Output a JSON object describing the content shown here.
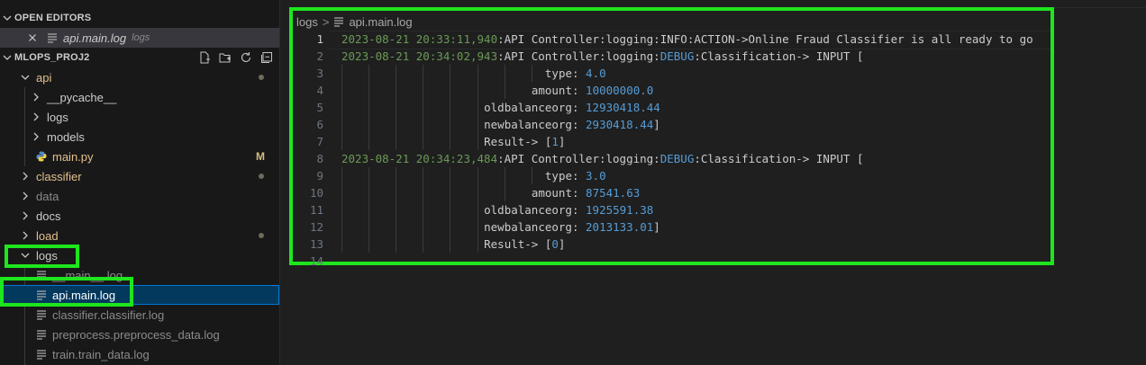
{
  "sidebar": {
    "open_editors": {
      "title": "OPEN EDITORS",
      "item": {
        "name": "api.main.log",
        "folder": "logs"
      }
    },
    "project": {
      "title": "MLOPS_PROJ2"
    },
    "tree": [
      {
        "label": "api",
        "kind": "folder",
        "open": true,
        "depth": 0,
        "color": "#e2c08d",
        "badge": "dot"
      },
      {
        "label": "__pycache__",
        "kind": "folder",
        "open": false,
        "depth": 1,
        "color": "#cccccc"
      },
      {
        "label": "logs",
        "kind": "folder",
        "open": false,
        "depth": 1,
        "color": "#cccccc"
      },
      {
        "label": "models",
        "kind": "folder",
        "open": false,
        "depth": 1,
        "color": "#cccccc"
      },
      {
        "label": "main.py",
        "kind": "python",
        "depth": 1,
        "color": "#e2c08d",
        "badge": "M"
      },
      {
        "label": "classifier",
        "kind": "folder",
        "open": false,
        "depth": 0,
        "color": "#e2c08d",
        "badge": "dot"
      },
      {
        "label": "data",
        "kind": "folder",
        "open": false,
        "depth": 0,
        "color": "#8b8b8b"
      },
      {
        "label": "docs",
        "kind": "folder",
        "open": false,
        "depth": 0,
        "color": "#cccccc"
      },
      {
        "label": "load",
        "kind": "folder",
        "open": false,
        "depth": 0,
        "color": "#e2c08d",
        "badge": "dot"
      },
      {
        "label": "logs",
        "kind": "folder",
        "open": true,
        "depth": 0,
        "color": "#cccccc"
      },
      {
        "label": "__main__.log",
        "kind": "log",
        "depth": 1,
        "color": "#8b8b8b"
      },
      {
        "label": "api.main.log",
        "kind": "log",
        "depth": 1,
        "color": "#ffffff",
        "selected": true
      },
      {
        "label": "classifier.classifier.log",
        "kind": "log",
        "depth": 1,
        "color": "#8b8b8b"
      },
      {
        "label": "preprocess.preprocess_data.log",
        "kind": "log",
        "depth": 1,
        "color": "#8b8b8b"
      },
      {
        "label": "train.train_data.log",
        "kind": "log",
        "depth": 1,
        "color": "#8b8b8b"
      }
    ]
  },
  "editor": {
    "breadcrumb": {
      "folder": "logs",
      "separator": ">",
      "file": "api.main.log"
    },
    "lines": [
      {
        "n": "1",
        "ts": "2023-08-21 20:33:11,940",
        "pre": ":API Controller:logging:",
        "lvl": "INFO",
        "post": ":ACTION->Online Fraud Classifier is all ready to go"
      },
      {
        "n": "2",
        "ts": "2023-08-21 20:34:02,943",
        "pre": ":API Controller:logging:",
        "lvl": "DEBUG",
        "post": ":Classification-> INPUT ["
      },
      {
        "n": "3",
        "key": "type: ",
        "val": "4.0",
        "tail": ""
      },
      {
        "n": "4",
        "key": "amount: ",
        "val": "10000000.0",
        "tail": ""
      },
      {
        "n": "5",
        "key": "oldbalanceorg: ",
        "val": "12930418.44",
        "tail": ""
      },
      {
        "n": "6",
        "key": "newbalanceorg: ",
        "val": "2930418.44",
        "tail": "]"
      },
      {
        "n": "7",
        "key": "Result-> [",
        "val": "1",
        "tail": "]"
      },
      {
        "n": "8",
        "ts": "2023-08-21 20:34:23,484",
        "pre": ":API Controller:logging:",
        "lvl": "DEBUG",
        "post": ":Classification-> INPUT ["
      },
      {
        "n": "9",
        "key": "type: ",
        "val": "3.0",
        "tail": ""
      },
      {
        "n": "10",
        "key": "amount: ",
        "val": "87541.63",
        "tail": ""
      },
      {
        "n": "11",
        "key": "oldbalanceorg: ",
        "val": "1925591.38",
        "tail": ""
      },
      {
        "n": "12",
        "key": "newbalanceorg: ",
        "val": "2013133.01",
        "tail": "]"
      },
      {
        "n": "13",
        "key": "Result-> [",
        "val": "0",
        "tail": "]"
      },
      {
        "n": "14"
      }
    ]
  },
  "colors": {
    "highlight_box": "#1ee61e",
    "modified_file": "#e2c08d",
    "timestamp": "#6a9955",
    "number": "#569cd6"
  }
}
